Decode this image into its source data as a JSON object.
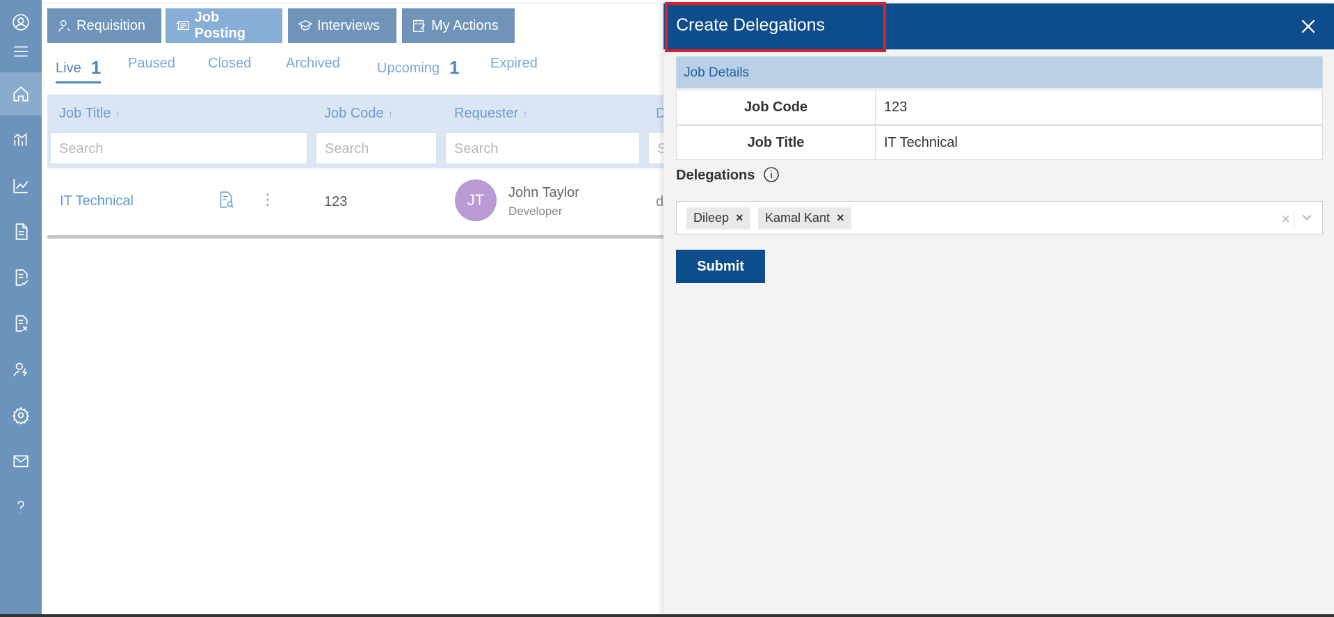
{
  "tabs": [
    {
      "label": "Requisition",
      "icon": "user-search-icon"
    },
    {
      "label": "Job Posting",
      "icon": "newspaper-icon",
      "active": true
    },
    {
      "label": "Interviews",
      "icon": "graduation-cap-icon"
    },
    {
      "label": "My Actions",
      "icon": "edit-calendar-icon"
    }
  ],
  "subtabs": [
    {
      "label": "Live",
      "count": "1",
      "active": true
    },
    {
      "label": "Paused"
    },
    {
      "label": "Closed"
    },
    {
      "label": "Archived"
    },
    {
      "label": "Upcoming",
      "count": "1"
    },
    {
      "label": "Expired"
    }
  ],
  "table": {
    "columns": [
      {
        "label": "Job Title",
        "arrow": "↑",
        "placeholder": "Search"
      },
      {
        "label": "Job Code",
        "arrow": "↑",
        "placeholder": "Search"
      },
      {
        "label": "Requester",
        "arrow": "↑",
        "placeholder": "Search"
      },
      {
        "label": "D",
        "placeholder": "S"
      }
    ],
    "row": {
      "job_title": "IT Technical",
      "job_code": "123",
      "requester_initials": "JT",
      "requester_name": "John Taylor",
      "requester_role": "Developer",
      "partial": "d"
    }
  },
  "panel": {
    "title": "Create Delegations",
    "job_details_heading": "Job Details",
    "job_code_label": "Job Code",
    "job_code_value": "123",
    "job_title_label": "Job Title",
    "job_title_value": "IT Technical",
    "delegations_label": "Delegations",
    "chips": [
      "Dileep",
      "Kamal Kant"
    ],
    "chip_remove": "×",
    "clear": "×",
    "submit_label": "Submit"
  },
  "colors": {
    "sidebar": "#6b93bb",
    "panel_header": "#0e4d8c",
    "highlight": "#e11d26",
    "tab": "#6f93b9"
  }
}
